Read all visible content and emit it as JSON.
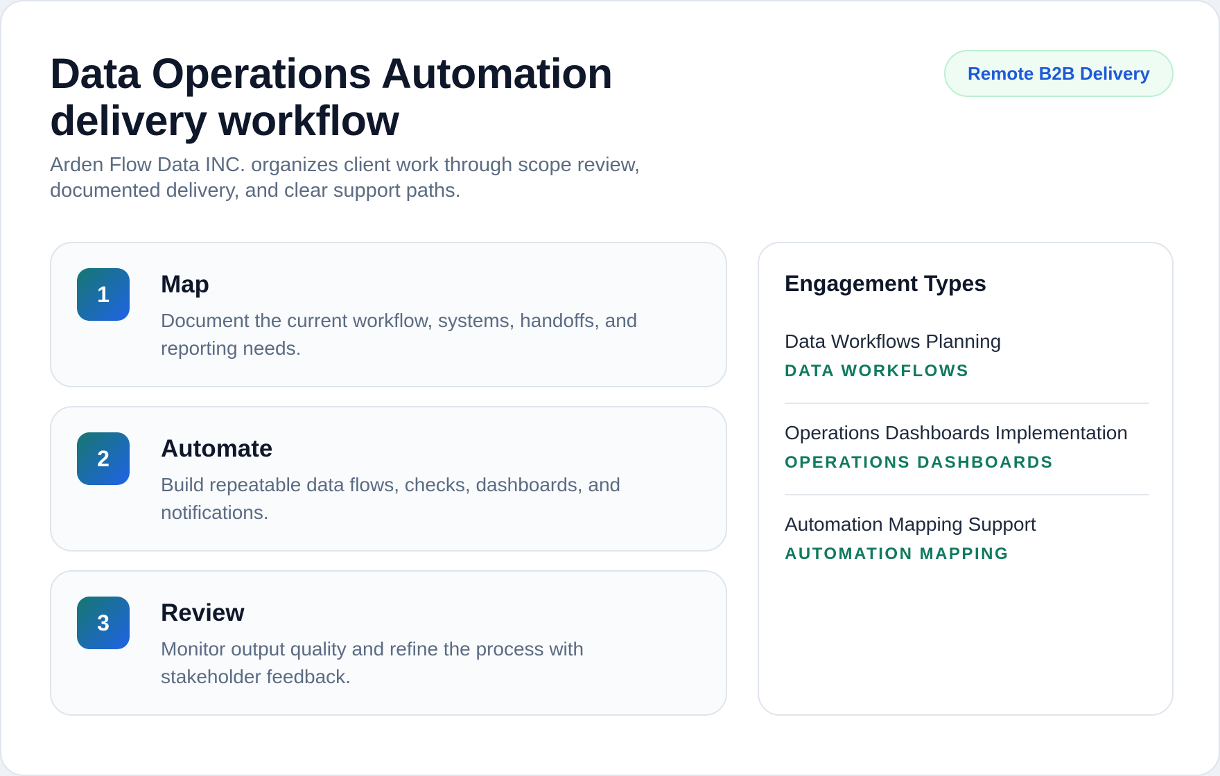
{
  "header": {
    "title": "Data Operations Automation delivery workflow",
    "subtitle": "Arden Flow Data INC. organizes client work through scope review, documented delivery, and clear support paths.",
    "badge": "Remote B2B Delivery"
  },
  "steps": [
    {
      "number": "1",
      "title": "Map",
      "description": "Document the current workflow, systems, handoffs, and reporting needs."
    },
    {
      "number": "2",
      "title": "Automate",
      "description": "Build repeatable data flows, checks, dashboards, and notifications."
    },
    {
      "number": "3",
      "title": "Review",
      "description": "Monitor output quality and refine the process with stakeholder feedback."
    }
  ],
  "engagement": {
    "title": "Engagement Types",
    "items": [
      {
        "name": "Data Workflows Planning",
        "tag": "DATA WORKFLOWS"
      },
      {
        "name": "Operations Dashboards Implementation",
        "tag": "OPERATIONS DASHBOARDS"
      },
      {
        "name": "Automation Mapping Support",
        "tag": "AUTOMATION MAPPING"
      }
    ]
  },
  "colors": {
    "accent_blue": "#1d5ad8",
    "accent_green": "#0f7a5f",
    "badge_bg": "#effcf4",
    "step_gradient_start": "#17776f",
    "step_gradient_end": "#1f63e6"
  }
}
